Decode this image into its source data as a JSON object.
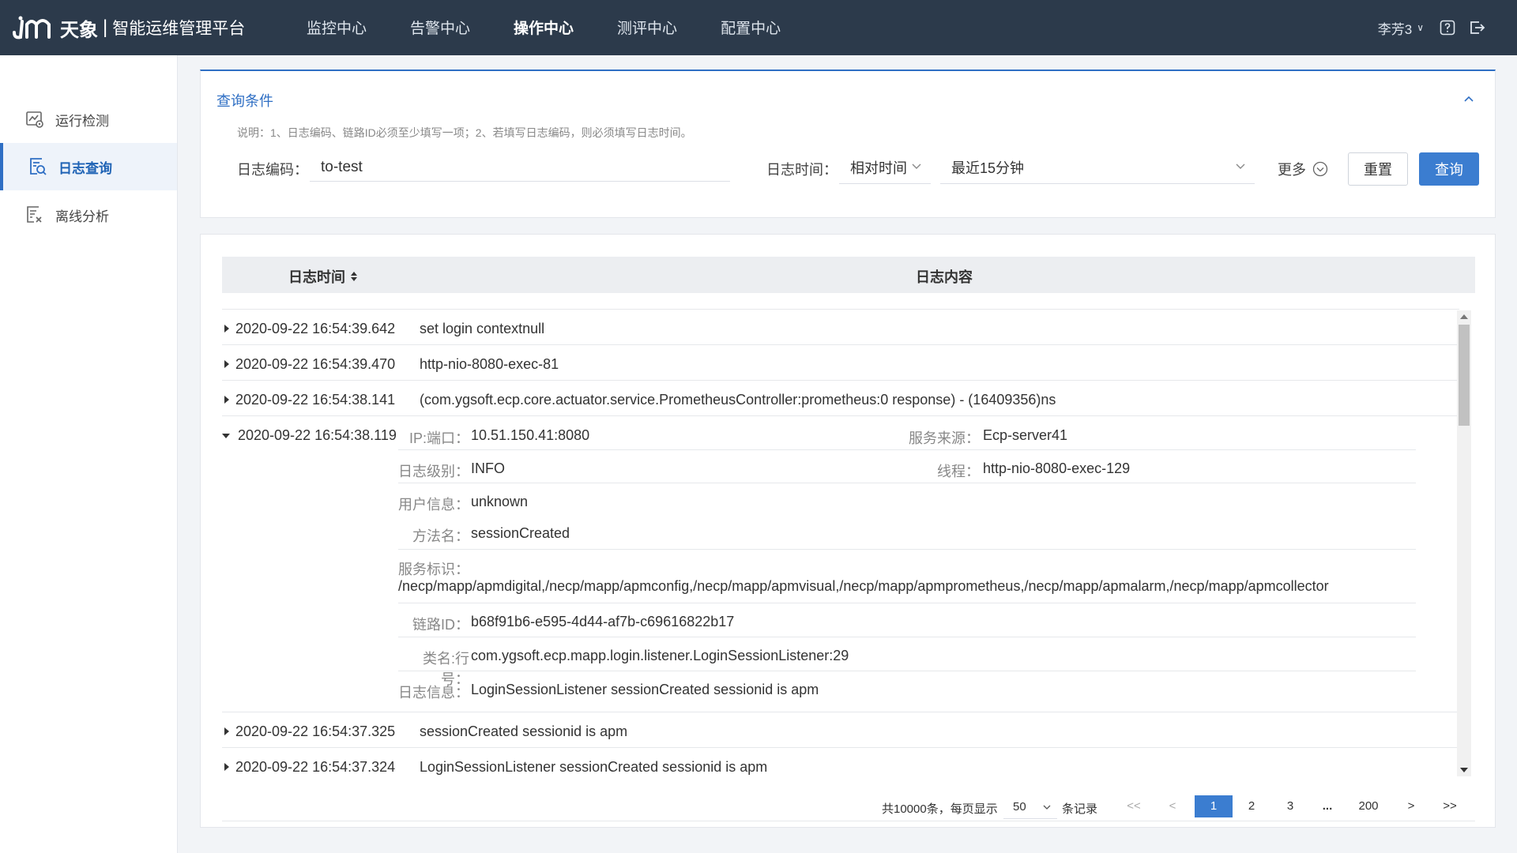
{
  "app": {
    "brand": "天象",
    "separator": "|",
    "subtitle": "智能运维管理平台"
  },
  "nav": {
    "items": [
      {
        "label": "监控中心"
      },
      {
        "label": "告警中心"
      },
      {
        "label": "操作中心",
        "active": true
      },
      {
        "label": "测评中心"
      },
      {
        "label": "配置中心"
      }
    ]
  },
  "user": {
    "name": "李芳3",
    "caret": "∨"
  },
  "sidebar": {
    "items": [
      {
        "label": "运行检测",
        "icon": "monitor-chart-icon"
      },
      {
        "label": "日志查询",
        "icon": "log-search-icon",
        "active": true
      },
      {
        "label": "离线分析",
        "icon": "offline-analysis-icon"
      }
    ]
  },
  "query": {
    "title": "查询条件",
    "note": "说明：1、日志编码、链路ID必须至少填写一项；2、若填写日志编码，则必须填写日志时间。",
    "code_label": "日志编码：",
    "code_value": "to-test",
    "time_label": "日志时间：",
    "time_mode": "相对时间",
    "time_range": "最近15分钟",
    "more_label": "更多",
    "reset_label": "重置",
    "search_label": "查询"
  },
  "table": {
    "col_time": "日志时间",
    "col_content": "日志内容",
    "rows_before": [
      {
        "time": "2020-09-22 16:54:39.642",
        "msg": "set login contextnull"
      },
      {
        "time": "2020-09-22 16:54:39.470",
        "msg": "http-nio-8080-exec-81"
      },
      {
        "time": "2020-09-22 16:54:38.141",
        "msg": "(com.ygsoft.ecp.core.actuator.service.PrometheusController:prometheus:0 response) - (16409356)ns"
      }
    ],
    "expanded": {
      "time": "2020-09-22 16:54:38.119",
      "ip_label": "IP:端口：",
      "ip_value": "10.51.150.41:8080",
      "source_label": "服务来源：",
      "source_value": "Ecp-server41",
      "level_label": "日志级别：",
      "level_value": "INFO",
      "thread_label": "线程：",
      "thread_value": "http-nio-8080-exec-129",
      "user_label": "用户信息：",
      "user_value": "unknown",
      "method_label": "方法名：",
      "method_value": "sessionCreated",
      "service_label": "服务标识：",
      "service_value": "/necp/mapp/apmdigital,/necp/mapp/apmconfig,/necp/mapp/apmvisual,/necp/mapp/apmprometheus,/necp/mapp/apmalarm,/necp/mapp/apmcollector",
      "trace_label": "链路ID：",
      "trace_value": "b68f91b6-e595-4d44-af7b-c69616822b17",
      "class_label": "类名:行号：",
      "class_value": "com.ygsoft.ecp.mapp.login.listener.LoginSessionListener:29",
      "info_label": "日志信息：",
      "info_value": "LoginSessionListener sessionCreated sessionid is apm"
    },
    "rows_after": [
      {
        "time": "2020-09-22 16:54:37.325",
        "msg": "sessionCreated sessionid is apm"
      },
      {
        "time": "2020-09-22 16:54:37.324",
        "msg": "LoginSessionListener sessionCreated sessionid is apm"
      }
    ]
  },
  "pager": {
    "total": "共10000条，每页显示",
    "page_size": "50",
    "unit": "条记录",
    "first": "<<",
    "prev": "<",
    "pages": [
      "1",
      "2",
      "3"
    ],
    "ellipsis": "...",
    "last_page": "200",
    "next": ">",
    "last": ">>",
    "current": "1"
  },
  "colors": {
    "header_bg": "#2c3a4b",
    "accent": "#2f6fc4",
    "button_primary": "#3b7dd0"
  }
}
